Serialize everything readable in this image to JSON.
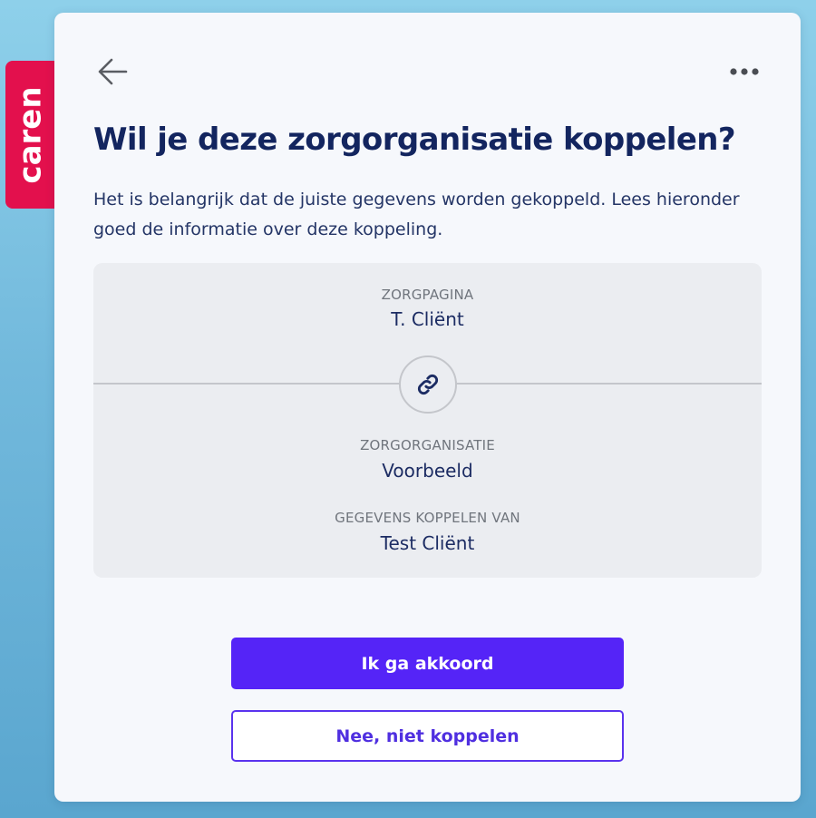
{
  "brand": {
    "name": "caren",
    "color": "#e3104d"
  },
  "header": {
    "back_icon": "arrow-left-icon",
    "more_icon": "more-horizontal-icon"
  },
  "dialog": {
    "title": "Wil je deze zorgorganisatie koppelen?",
    "intro": "Het is belangrijk dat de juiste gegevens worden gekoppeld. Lees hieronder goed de informatie over deze koppeling."
  },
  "info": {
    "page_label": "ZORGPAGINA",
    "page_value": "T. Cliënt",
    "link_icon": "link-icon",
    "org_label": "ZORGORGANISATIE",
    "org_value": "Voorbeeld",
    "data_label": "GEGEVENS KOPPELEN VAN",
    "data_value": "Test Cliënt"
  },
  "actions": {
    "accept_label": "Ik ga akkoord",
    "decline_label": "Nee, niet koppelen"
  },
  "colors": {
    "primary": "#5524f7",
    "title": "#13255f",
    "card_background": "#f6f8fc",
    "info_background": "#ebedf1"
  }
}
